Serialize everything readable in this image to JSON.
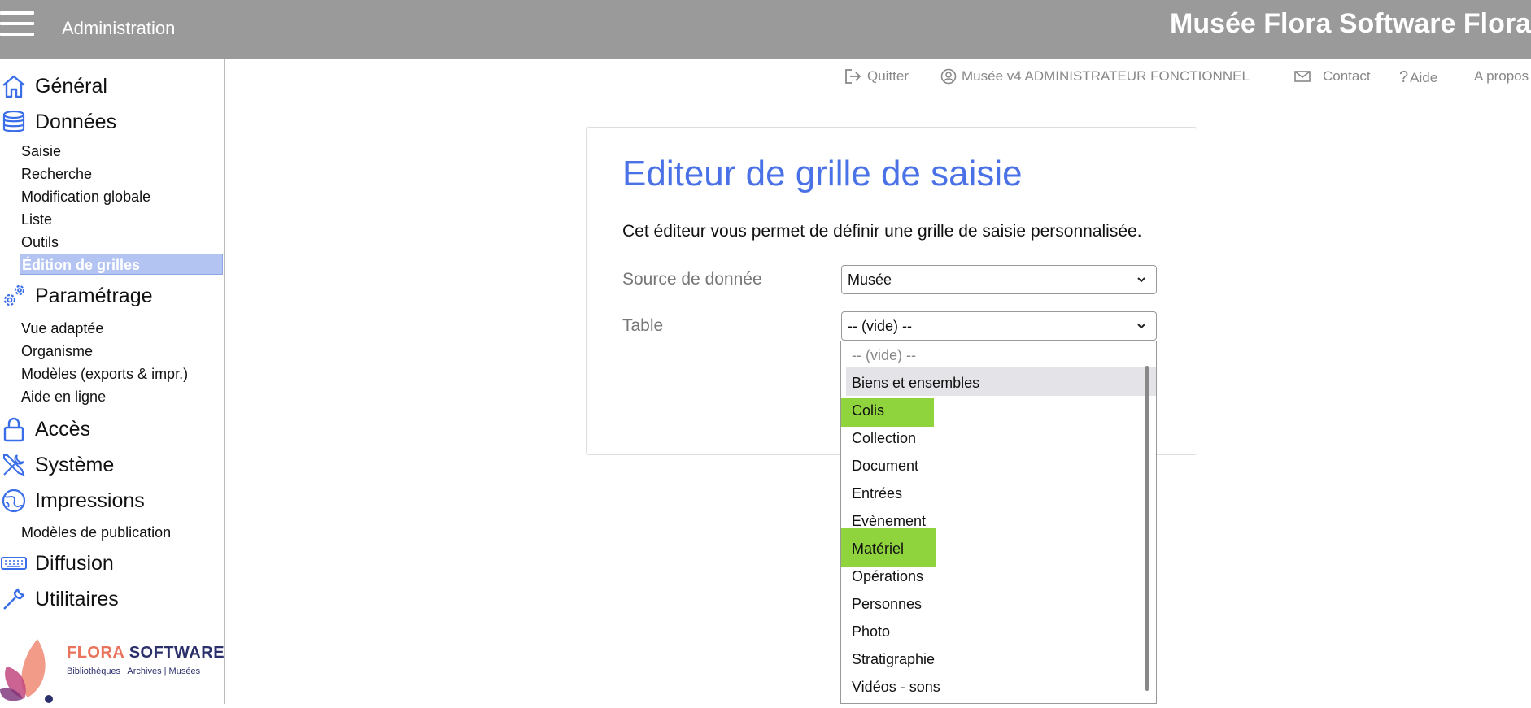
{
  "header": {
    "section": "Administration",
    "title": "Musée Flora Software Flora"
  },
  "sidebar": {
    "general": "Général",
    "donnees": {
      "label": "Données",
      "items": [
        "Saisie",
        "Recherche",
        "Modification globale",
        "Liste",
        "Outils",
        "Édition de grilles"
      ]
    },
    "parametrage": {
      "label": "Paramétrage",
      "items": [
        "Vue adaptée",
        "Organisme",
        "Modèles (exports & impr.)",
        "Aide en ligne"
      ]
    },
    "acces": "Accès",
    "systeme": "Système",
    "impressions": {
      "label": "Impressions",
      "items": [
        "Modèles de publication"
      ]
    },
    "diffusion": "Diffusion",
    "utilitaires": "Utilitaires",
    "logo": {
      "name_part1": "FLORA",
      "name_part2": " SOFTWARE",
      "tagline": "Bibliothèques | Archives | Musées"
    }
  },
  "toplinks": {
    "quitter": "Quitter",
    "user": "Musée v4 ADMINISTRATEUR FONCTIONNEL",
    "contact": "Contact",
    "aide": "Aide",
    "apropos": "A propos"
  },
  "editor": {
    "title": "Editeur de grille de saisie",
    "description": "Cet éditeur vous permet de définir une grille de saisie personnalisée.",
    "source_label": "Source de donnée",
    "source_value": "Musée",
    "table_label": "Table",
    "table_value": "-- (vide) --"
  },
  "dropdown": {
    "options": [
      "-- (vide) --",
      "Biens et ensembles",
      "Colis",
      "Collection",
      "Document",
      "Entrées",
      "Evènement",
      "Matériel",
      "Opérations",
      "Personnes",
      "Photo",
      "Stratigraphie",
      "Vidéos - sons"
    ]
  },
  "colors": {
    "accent": "#4a72e6",
    "header_bg": "#9a9a9a",
    "highlight": "#8fd43c",
    "active_item": "#b3c4f2"
  }
}
